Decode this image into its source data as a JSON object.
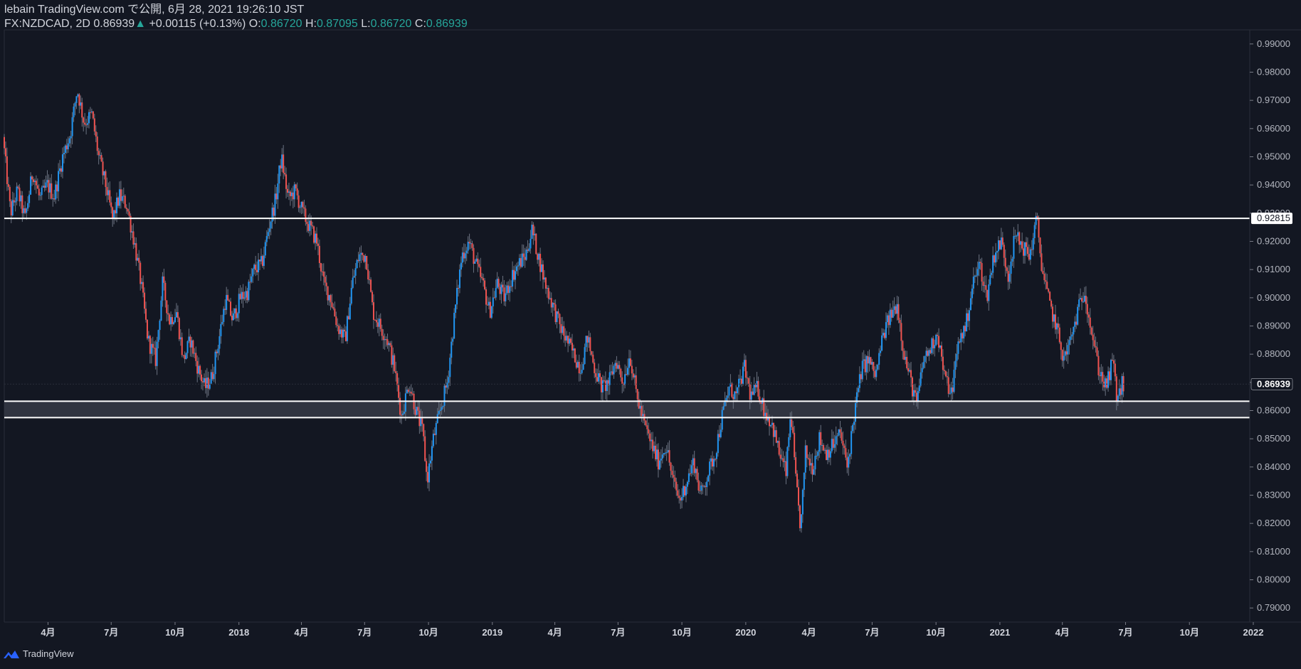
{
  "header": {
    "line1": "lebain TradingView.com で公開, 6月 28, 2021 19:26:10 JST",
    "symbol": "FX:NZDCAD, 2D",
    "last": "0.86939",
    "change_arrow": "▲",
    "change": "+0.00115 (+0.13%)",
    "o_label": "O:",
    "o": "0.86720",
    "h_label": "H:",
    "h": "0.87095",
    "l_label": "L:",
    "l": "0.86720",
    "c_label": "C:",
    "c": "0.86939"
  },
  "footer": {
    "brand": "TradingView",
    "icon": "tradingview-logo-icon"
  },
  "colors": {
    "background": "#131722",
    "up": "#2196f3",
    "down": "#ef5350",
    "level_line": "#ffffff",
    "zone_fill": "#363a45",
    "axis_text": "#b2b5be"
  },
  "chart_data": {
    "type": "candlestick",
    "symbol": "FX:NZDCAD",
    "interval": "2D",
    "ylim": [
      0.785,
      0.995
    ],
    "yticks": [
      "0.99000",
      "0.98000",
      "0.97000",
      "0.96000",
      "0.95000",
      "0.94000",
      "0.93000",
      "0.92000",
      "0.91000",
      "0.90000",
      "0.89000",
      "0.88000",
      "0.87000",
      "0.86000",
      "0.85000",
      "0.84000",
      "0.83000",
      "0.82000",
      "0.81000",
      "0.80000",
      "0.79000"
    ],
    "xlim": [
      "2017-01-28",
      "2021-12-31"
    ],
    "xticks": [
      {
        "label": "4月",
        "date": "2017-04-01"
      },
      {
        "label": "7月",
        "date": "2017-07-01"
      },
      {
        "label": "10月",
        "date": "2017-10-01"
      },
      {
        "label": "2018",
        "date": "2018-01-01"
      },
      {
        "label": "4月",
        "date": "2018-04-01"
      },
      {
        "label": "7月",
        "date": "2018-07-01"
      },
      {
        "label": "10月",
        "date": "2018-10-01"
      },
      {
        "label": "2019",
        "date": "2019-01-01"
      },
      {
        "label": "4月",
        "date": "2019-04-01"
      },
      {
        "label": "7月",
        "date": "2019-07-01"
      },
      {
        "label": "10月",
        "date": "2019-10-01"
      },
      {
        "label": "2020",
        "date": "2020-01-01"
      },
      {
        "label": "4月",
        "date": "2020-04-01"
      },
      {
        "label": "7月",
        "date": "2020-07-01"
      },
      {
        "label": "10月",
        "date": "2020-10-01"
      },
      {
        "label": "2021",
        "date": "2021-01-01"
      },
      {
        "label": "4月",
        "date": "2021-04-01"
      },
      {
        "label": "7月",
        "date": "2021-07-01"
      },
      {
        "label": "10月",
        "date": "2021-10-01"
      },
      {
        "label": "2022",
        "date": "2022-01-01"
      }
    ],
    "hlines": [
      {
        "value": 0.92815,
        "label": "0.92815"
      },
      {
        "value": 0.8633
      },
      {
        "value": 0.8575
      }
    ],
    "zone": [
      0.8575,
      0.8633
    ],
    "last_price": {
      "value": 0.86939,
      "label": "0.86939"
    },
    "price_path": [
      [
        "2017-01-28",
        0.957
      ],
      [
        "2017-02-08",
        0.93
      ],
      [
        "2017-02-18",
        0.938
      ],
      [
        "2017-03-01",
        0.928
      ],
      [
        "2017-03-12",
        0.945
      ],
      [
        "2017-03-22",
        0.935
      ],
      [
        "2017-04-02",
        0.94
      ],
      [
        "2017-04-12",
        0.936
      ],
      [
        "2017-04-24",
        0.95
      ],
      [
        "2017-05-05",
        0.958
      ],
      [
        "2017-05-15",
        0.974
      ],
      [
        "2017-05-25",
        0.962
      ],
      [
        "2017-06-05",
        0.965
      ],
      [
        "2017-06-15",
        0.95
      ],
      [
        "2017-06-25",
        0.94
      ],
      [
        "2017-07-05",
        0.928
      ],
      [
        "2017-07-15",
        0.936
      ],
      [
        "2017-07-25",
        0.933
      ],
      [
        "2017-08-05",
        0.92
      ],
      [
        "2017-08-15",
        0.905
      ],
      [
        "2017-08-25",
        0.885
      ],
      [
        "2017-09-05",
        0.878
      ],
      [
        "2017-09-15",
        0.905
      ],
      [
        "2017-09-25",
        0.892
      ],
      [
        "2017-10-05",
        0.895
      ],
      [
        "2017-10-15",
        0.878
      ],
      [
        "2017-10-25",
        0.885
      ],
      [
        "2017-11-05",
        0.875
      ],
      [
        "2017-11-15",
        0.868
      ],
      [
        "2017-11-25",
        0.872
      ],
      [
        "2017-12-05",
        0.885
      ],
      [
        "2017-12-15",
        0.9
      ],
      [
        "2017-12-25",
        0.892
      ],
      [
        "2018-01-05",
        0.9
      ],
      [
        "2018-01-15",
        0.902
      ],
      [
        "2018-01-25",
        0.91
      ],
      [
        "2018-02-05",
        0.912
      ],
      [
        "2018-02-15",
        0.925
      ],
      [
        "2018-02-25",
        0.935
      ],
      [
        "2018-03-05",
        0.95
      ],
      [
        "2018-03-15",
        0.935
      ],
      [
        "2018-03-25",
        0.938
      ],
      [
        "2018-04-05",
        0.93
      ],
      [
        "2018-04-15",
        0.925
      ],
      [
        "2018-04-25",
        0.92
      ],
      [
        "2018-05-05",
        0.905
      ],
      [
        "2018-05-15",
        0.9
      ],
      [
        "2018-05-25",
        0.89
      ],
      [
        "2018-06-05",
        0.885
      ],
      [
        "2018-06-15",
        0.905
      ],
      [
        "2018-06-25",
        0.915
      ],
      [
        "2018-07-05",
        0.915
      ],
      [
        "2018-07-15",
        0.895
      ],
      [
        "2018-07-25",
        0.89
      ],
      [
        "2018-08-05",
        0.885
      ],
      [
        "2018-08-15",
        0.875
      ],
      [
        "2018-08-25",
        0.858
      ],
      [
        "2018-09-05",
        0.87
      ],
      [
        "2018-09-15",
        0.86
      ],
      [
        "2018-09-25",
        0.852
      ],
      [
        "2018-10-01",
        0.835
      ],
      [
        "2018-10-10",
        0.85
      ],
      [
        "2018-10-20",
        0.86
      ],
      [
        "2018-10-30",
        0.87
      ],
      [
        "2018-11-10",
        0.895
      ],
      [
        "2018-11-20",
        0.915
      ],
      [
        "2018-11-30",
        0.92
      ],
      [
        "2018-12-10",
        0.912
      ],
      [
        "2018-12-20",
        0.905
      ],
      [
        "2018-12-30",
        0.895
      ],
      [
        "2019-01-10",
        0.905
      ],
      [
        "2019-01-20",
        0.9
      ],
      [
        "2019-02-01",
        0.908
      ],
      [
        "2019-02-10",
        0.912
      ],
      [
        "2019-02-20",
        0.915
      ],
      [
        "2019-03-01",
        0.924
      ],
      [
        "2019-03-10",
        0.915
      ],
      [
        "2019-03-20",
        0.905
      ],
      [
        "2019-03-30",
        0.898
      ],
      [
        "2019-04-10",
        0.89
      ],
      [
        "2019-04-20",
        0.885
      ],
      [
        "2019-04-30",
        0.88
      ],
      [
        "2019-05-10",
        0.875
      ],
      [
        "2019-05-20",
        0.886
      ],
      [
        "2019-05-30",
        0.875
      ],
      [
        "2019-06-10",
        0.868
      ],
      [
        "2019-06-20",
        0.87
      ],
      [
        "2019-06-30",
        0.878
      ],
      [
        "2019-07-10",
        0.87
      ],
      [
        "2019-07-20",
        0.88
      ],
      [
        "2019-07-30",
        0.865
      ],
      [
        "2019-08-10",
        0.855
      ],
      [
        "2019-08-20",
        0.848
      ],
      [
        "2019-08-30",
        0.842
      ],
      [
        "2019-09-10",
        0.848
      ],
      [
        "2019-09-20",
        0.835
      ],
      [
        "2019-09-30",
        0.828
      ],
      [
        "2019-10-10",
        0.835
      ],
      [
        "2019-10-20",
        0.842
      ],
      [
        "2019-10-30",
        0.83
      ],
      [
        "2019-11-10",
        0.838
      ],
      [
        "2019-11-20",
        0.845
      ],
      [
        "2019-11-30",
        0.858
      ],
      [
        "2019-12-10",
        0.868
      ],
      [
        "2019-12-20",
        0.865
      ],
      [
        "2020-01-01",
        0.875
      ],
      [
        "2020-01-10",
        0.865
      ],
      [
        "2020-01-20",
        0.868
      ],
      [
        "2020-01-30",
        0.86
      ],
      [
        "2020-02-10",
        0.855
      ],
      [
        "2020-02-20",
        0.845
      ],
      [
        "2020-03-01",
        0.838
      ],
      [
        "2020-03-08",
        0.86
      ],
      [
        "2020-03-15",
        0.835
      ],
      [
        "2020-03-22",
        0.818
      ],
      [
        "2020-03-29",
        0.845
      ],
      [
        "2020-04-08",
        0.84
      ],
      [
        "2020-04-18",
        0.85
      ],
      [
        "2020-04-28",
        0.845
      ],
      [
        "2020-05-08",
        0.848
      ],
      [
        "2020-05-18",
        0.852
      ],
      [
        "2020-05-28",
        0.84
      ],
      [
        "2020-06-08",
        0.86
      ],
      [
        "2020-06-18",
        0.875
      ],
      [
        "2020-06-28",
        0.878
      ],
      [
        "2020-07-08",
        0.872
      ],
      [
        "2020-07-18",
        0.886
      ],
      [
        "2020-07-28",
        0.893
      ],
      [
        "2020-08-08",
        0.898
      ],
      [
        "2020-08-18",
        0.88
      ],
      [
        "2020-08-28",
        0.87
      ],
      [
        "2020-09-05",
        0.862
      ],
      [
        "2020-09-15",
        0.878
      ],
      [
        "2020-09-25",
        0.882
      ],
      [
        "2020-10-05",
        0.888
      ],
      [
        "2020-10-15",
        0.872
      ],
      [
        "2020-10-25",
        0.866
      ],
      [
        "2020-11-05",
        0.885
      ],
      [
        "2020-11-15",
        0.89
      ],
      [
        "2020-11-25",
        0.905
      ],
      [
        "2020-12-05",
        0.912
      ],
      [
        "2020-12-15",
        0.9
      ],
      [
        "2020-12-25",
        0.915
      ],
      [
        "2021-01-05",
        0.92
      ],
      [
        "2021-01-15",
        0.908
      ],
      [
        "2021-01-25",
        0.922
      ],
      [
        "2021-02-05",
        0.918
      ],
      [
        "2021-02-15",
        0.915
      ],
      [
        "2021-02-25",
        0.928
      ],
      [
        "2021-03-05",
        0.91
      ],
      [
        "2021-03-15",
        0.898
      ],
      [
        "2021-03-25",
        0.89
      ],
      [
        "2021-04-05",
        0.878
      ],
      [
        "2021-04-15",
        0.885
      ],
      [
        "2021-04-25",
        0.895
      ],
      [
        "2021-05-05",
        0.903
      ],
      [
        "2021-05-15",
        0.888
      ],
      [
        "2021-05-25",
        0.875
      ],
      [
        "2021-06-05",
        0.868
      ],
      [
        "2021-06-15",
        0.878
      ],
      [
        "2021-06-20",
        0.865
      ],
      [
        "2021-06-25",
        0.866
      ],
      [
        "2021-06-28",
        0.8694
      ]
    ]
  }
}
